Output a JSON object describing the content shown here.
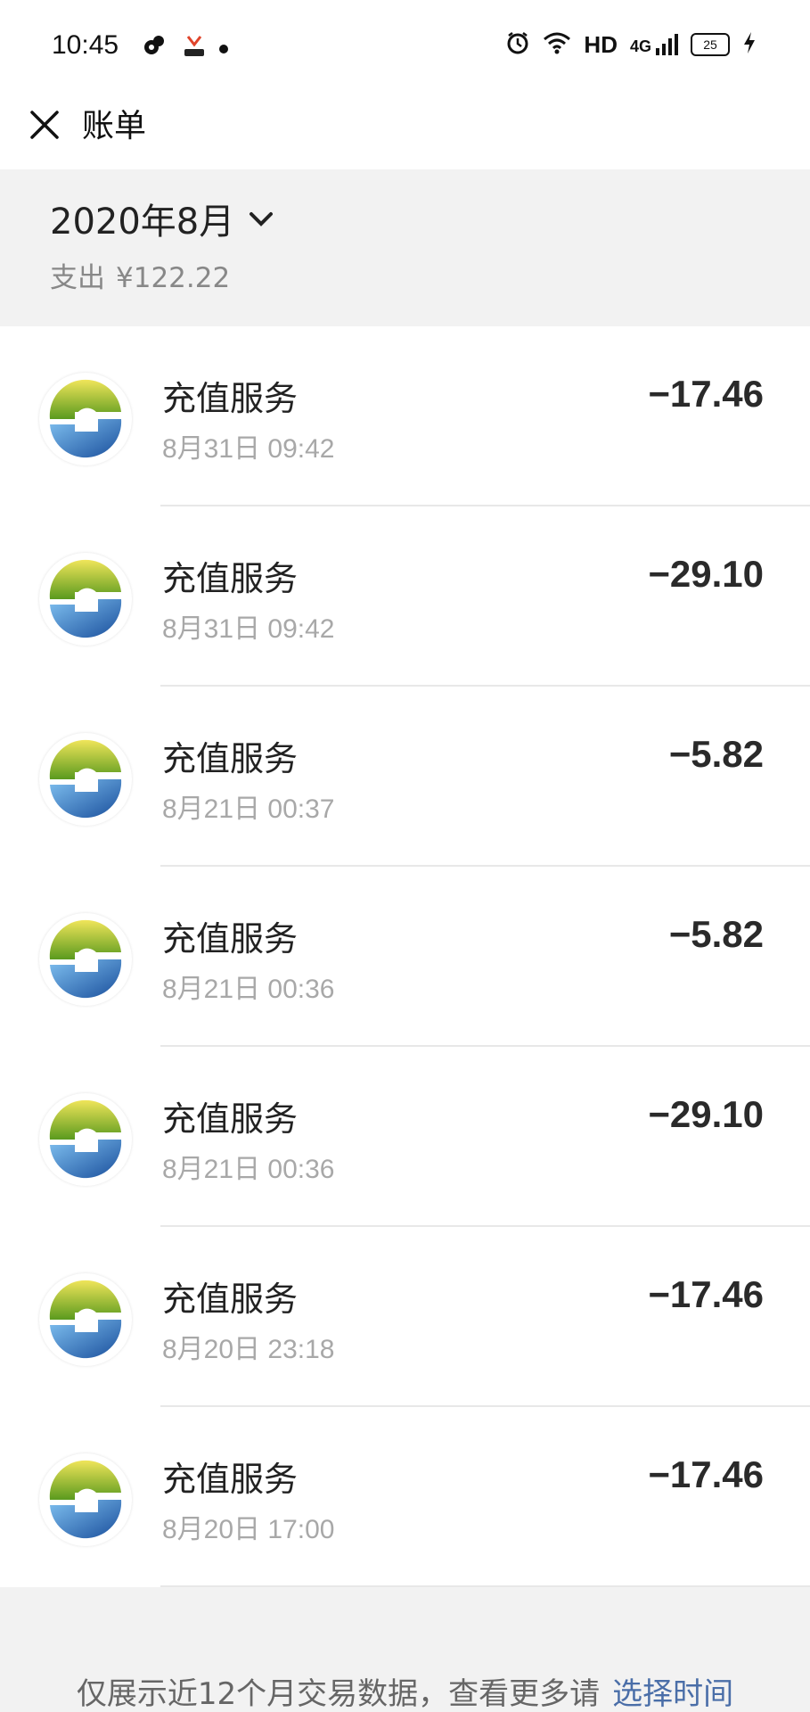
{
  "status_bar": {
    "time": "10:45",
    "hd": "HD",
    "network": "4G",
    "battery": "25"
  },
  "header": {
    "title": "账单"
  },
  "summary": {
    "month": "2020年8月",
    "expense_label": "支出",
    "expense_amount": "¥122.22"
  },
  "transactions": [
    {
      "name": "充值服务",
      "date": "8月31日 09:42",
      "amount": "−17.46"
    },
    {
      "name": "充值服务",
      "date": "8月31日 09:42",
      "amount": "−29.10"
    },
    {
      "name": "充值服务",
      "date": "8月21日 00:37",
      "amount": "−5.82"
    },
    {
      "name": "充值服务",
      "date": "8月21日 00:36",
      "amount": "−5.82"
    },
    {
      "name": "充值服务",
      "date": "8月21日 00:36",
      "amount": "−29.10"
    },
    {
      "name": "充值服务",
      "date": "8月20日 23:18",
      "amount": "−17.46"
    },
    {
      "name": "充值服务",
      "date": "8月20日 17:00",
      "amount": "−17.46"
    }
  ],
  "footer": {
    "text": "仅展示近12个月交易数据，查看更多请",
    "link": "选择时间"
  },
  "colors": {
    "link": "#4a6ea8",
    "background": "#f2f2f2"
  },
  "icons": {
    "close": "close-icon",
    "month_dropdown": "chevron-down-icon",
    "merchant": "merchant-logo-icon"
  }
}
